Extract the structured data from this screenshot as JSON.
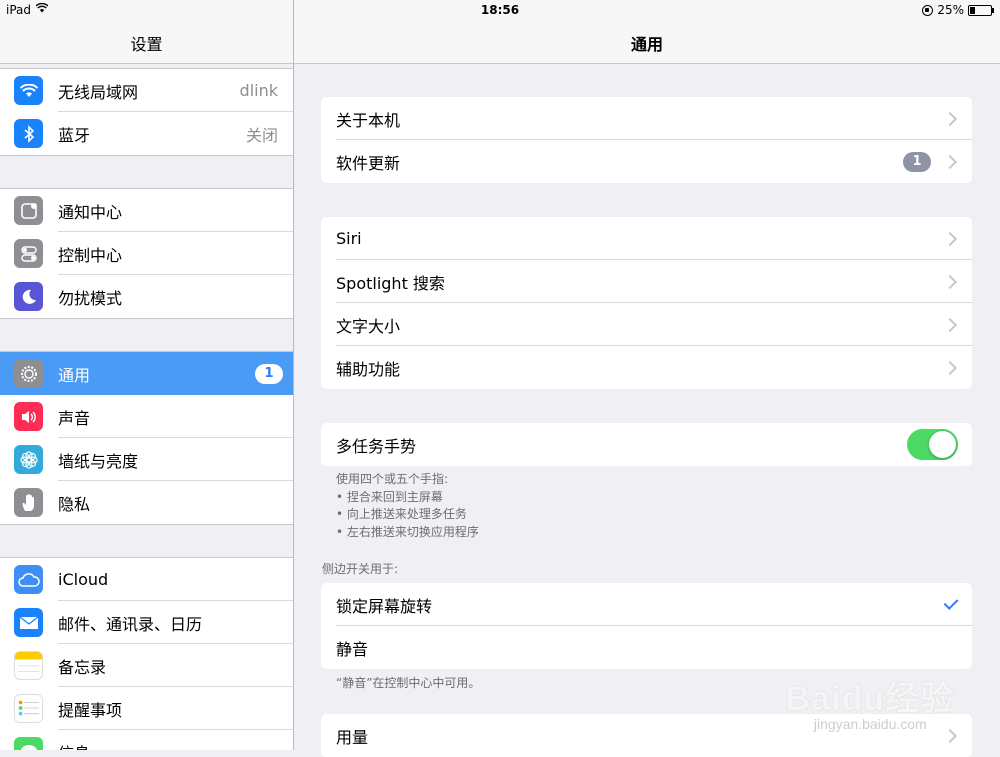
{
  "status": {
    "carrier": "iPad",
    "time": "18:56",
    "battery": "25%",
    "battery_level": 0.25
  },
  "sidebar": {
    "title": "设置",
    "groups": [
      [
        {
          "label": "无线局域网",
          "value": "dlink",
          "icon": "wifi-icon",
          "color": "#1a82fb"
        },
        {
          "label": "蓝牙",
          "value": "关闭",
          "icon": "bluetooth-icon",
          "color": "#1a82fb"
        }
      ],
      [
        {
          "label": "通知中心",
          "icon": "notification-center-icon",
          "color": "#8e8e93"
        },
        {
          "label": "控制中心",
          "icon": "control-center-icon",
          "color": "#8e8e93"
        },
        {
          "label": "勿扰模式",
          "icon": "moon-icon",
          "color": "#5856d6"
        }
      ],
      [
        {
          "label": "通用",
          "badge": "1",
          "icon": "gear-icon",
          "color": "#8e8e93",
          "selected": true
        },
        {
          "label": "声音",
          "icon": "speaker-icon",
          "color": "#ff2d55"
        },
        {
          "label": "墙纸与亮度",
          "icon": "flower-icon",
          "color": "#34aadc"
        },
        {
          "label": "隐私",
          "icon": "hand-icon",
          "color": "#8e8e93"
        }
      ],
      [
        {
          "label": "iCloud",
          "icon": "cloud-icon",
          "color": "#3f8ef5"
        },
        {
          "label": "邮件、通讯录、日历",
          "icon": "mail-icon",
          "color": "#1a82fb"
        },
        {
          "label": "备忘录",
          "icon": "notes-icon",
          "color": "#ffcc00"
        },
        {
          "label": "提醒事项",
          "icon": "reminders-icon",
          "color": "#ffffff"
        },
        {
          "label": "信息",
          "icon": "messages-icon",
          "color": "#4cd964"
        }
      ]
    ]
  },
  "main": {
    "title": "通用",
    "group1": [
      {
        "label": "关于本机"
      },
      {
        "label": "软件更新",
        "badge": "1"
      }
    ],
    "group2": [
      {
        "label": "Siri"
      },
      {
        "label": "Spotlight 搜索"
      },
      {
        "label": "文字大小"
      },
      {
        "label": "辅助功能"
      }
    ],
    "multitask": {
      "label": "多任务手势",
      "on": true
    },
    "multitask_note": [
      "使用四个或五个手指:",
      "• 捏合来回到主屏幕",
      "• 向上推送来处理多任务",
      "• 左右推送来切换应用程序"
    ],
    "side_switch_header": "侧边开关用于:",
    "side_switch": [
      {
        "label": "锁定屏幕旋转",
        "checked": true
      },
      {
        "label": "静音",
        "checked": false
      }
    ],
    "side_switch_note": "“静音”在控制中心中可用。",
    "group5": [
      {
        "label": "用量"
      }
    ]
  },
  "watermark": {
    "logo": "Baidu经验",
    "sub": "jingyan.baidu.com"
  }
}
